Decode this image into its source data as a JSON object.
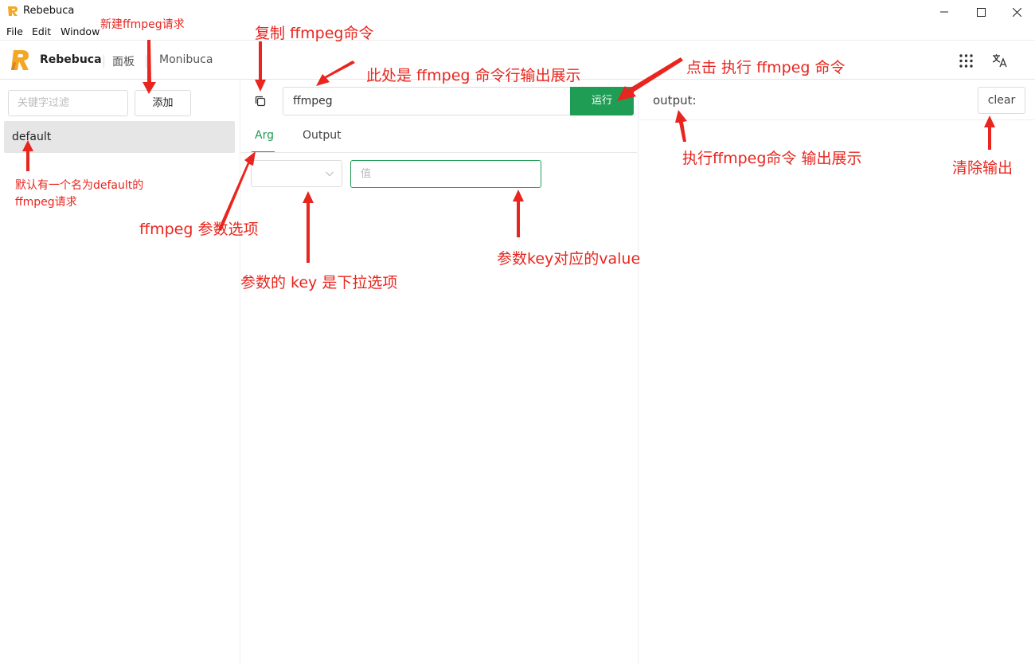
{
  "window": {
    "title": "Rebebuca",
    "controls": {
      "minimize": "—",
      "maximize": "☐",
      "close": "✕"
    }
  },
  "menu": {
    "file": "File",
    "edit": "Edit",
    "window": "Window"
  },
  "header": {
    "brand": "Rebebuca",
    "nav_panel": "面板",
    "nav_monibuca": "Monibuca"
  },
  "sidebar": {
    "filter_placeholder": "关键字过滤",
    "add_label": "添加",
    "items": [
      {
        "label": "default"
      }
    ]
  },
  "editor": {
    "command": "ffmpeg",
    "run_label": "运行",
    "tabs": [
      {
        "label": "Arg",
        "active": true
      },
      {
        "label": "Output",
        "active": false
      }
    ],
    "value_placeholder": "值"
  },
  "output": {
    "label": "output:",
    "clear_label": "clear"
  },
  "annotations": {
    "new_request": "新建ffmpeg请求",
    "copy_command": "复制 ffmpeg命令",
    "command_display": "此处是 ffmpeg 命令行输出展示",
    "run_command": "点击 执行 ffmpeg 命令",
    "default_request_line1": "默认有一个名为default的",
    "default_request_line2": "ffmpeg请求",
    "arg_options": "ffmpeg 参数选项",
    "key_dropdown": "参数的 key 是下拉选项",
    "key_value": "参数key对应的value",
    "output_display": "执行ffmpeg命令 输出展示",
    "clear_output": "清除输出"
  },
  "colors": {
    "accent": "#1f9d55",
    "annotation": "#e8251e",
    "brand_orange": "#f5a623"
  }
}
